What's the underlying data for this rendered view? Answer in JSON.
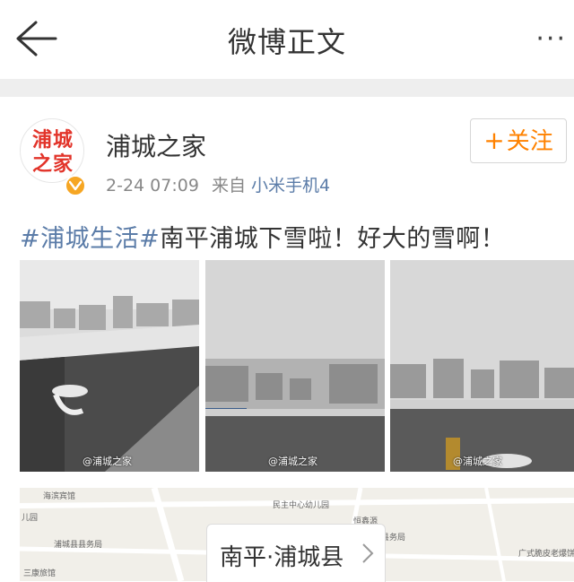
{
  "nav": {
    "title": "微博正文",
    "more": "···"
  },
  "author": {
    "avatar_text_line1": "浦城",
    "avatar_text_line2": "之家",
    "name": "浦城之家",
    "time": "2-24 07:09",
    "source_prefix": "来自",
    "device": "小米手机4"
  },
  "follow": {
    "plus": "+",
    "label": "关注"
  },
  "post": {
    "hashtag": "#浦城生活#",
    "text": "南平浦城下雪啦！好大的雪啊！"
  },
  "photos": [
    {
      "watermark": "@浦城之家"
    },
    {
      "watermark": "@浦城之家"
    },
    {
      "watermark": "@浦城之家"
    }
  ],
  "map": {
    "location": "南平·浦城县",
    "labels": [
      "海滨宾馆",
      "儿园",
      "民主中心幼儿园",
      "恒鑫源",
      "浦城县县务局",
      "三康旅馆",
      "广式脆皮老爆饼",
      "浦城县县务局"
    ]
  },
  "colors": {
    "accent": "#ff8200",
    "link": "#5b7ca8",
    "logo": "#e2342a",
    "badge": "#f6a623"
  },
  "icons": [
    "back-arrow-icon",
    "more-dots-icon",
    "verified-badge-icon",
    "chevron-right-icon"
  ]
}
